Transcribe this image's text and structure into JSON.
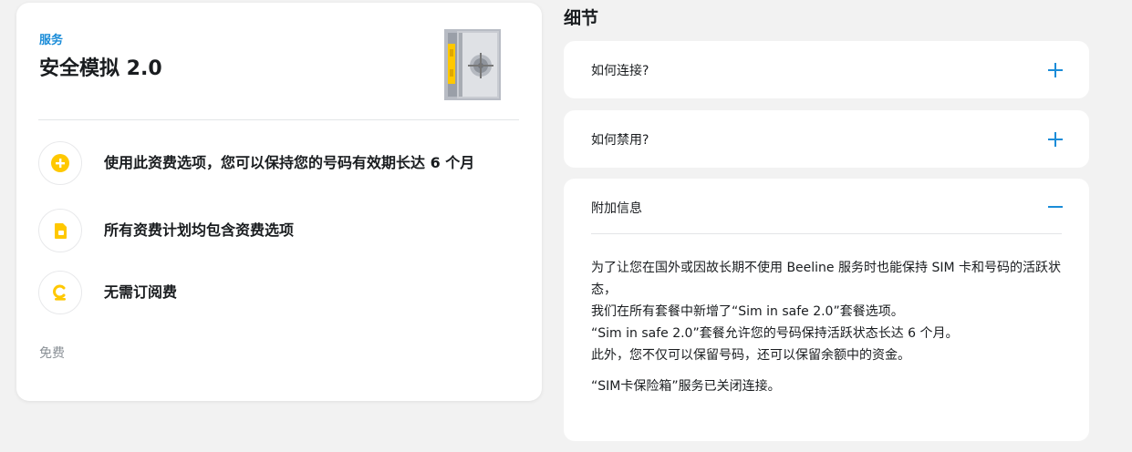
{
  "service_card": {
    "label": "服务",
    "title": "安全模拟 2.0",
    "features": [
      {
        "icon": "plus-circle-icon",
        "text": "使用此资费选项，您可以保持您的号码有效期长达 6 个月"
      },
      {
        "icon": "sim-card-icon",
        "text": "所有资费计划均包含资费选项"
      },
      {
        "icon": "ruble-icon",
        "text": "无需订阅费"
      }
    ],
    "price": "免费"
  },
  "details": {
    "heading": "细节",
    "items": [
      {
        "title": "如何连接?",
        "state": "collapsed"
      },
      {
        "title": "如何禁用?",
        "state": "collapsed"
      },
      {
        "title": "附加信息",
        "state": "expanded"
      }
    ],
    "expanded_body": {
      "lines": [
        "为了让您在国外或因故长期不使用 Beeline 服务时也能保持 SIM 卡和号码的活跃状态，",
        "我们在所有套餐中新增了“Sim in safe 2.0”套餐选项。",
        "“Sim in safe 2.0”套餐允许您的号码保持活跃状态长达 6 个月。",
        "此外，您不仅可以保留号码，还可以保留余额中的资金。"
      ],
      "note": "“SIM卡保险箱”服务已关闭连接。"
    }
  },
  "colors": {
    "accent_blue": "#1a8cd8",
    "beeline_yellow": "#ffc800",
    "background": "#f2f2f2"
  }
}
